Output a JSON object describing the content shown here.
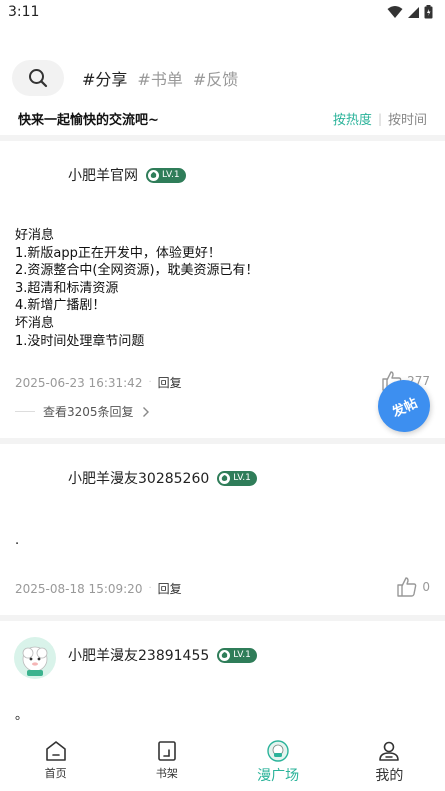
{
  "status": {
    "time": "3:11"
  },
  "header": {
    "tabs": [
      {
        "label": "#分享",
        "active": true
      },
      {
        "label": "#书单",
        "active": false
      },
      {
        "label": "#反馈",
        "active": false
      }
    ]
  },
  "subbar": {
    "slogan": "快来一起愉快的交流吧~",
    "sort_hot": "按热度",
    "sort_sep": "|",
    "sort_time": "按时间"
  },
  "posts": [
    {
      "user": "小肥羊官网",
      "level": "LV.1",
      "body": "好消息\n1.新版app正在开发中，体验更好！\n2.资源整合中(全网资源)，耽美资源已有！\n3.超清和标清资源\n4.新增广播剧！\n坏消息\n1.没时间处理章节问题",
      "time": "2025-06-23 16:31:42",
      "reply": "回复",
      "likes": "277",
      "view_replies": "查看3205条回复"
    },
    {
      "user": "小肥羊漫友30285260",
      "level": "LV.1",
      "body": ".",
      "time": "2025-08-18 15:09:20",
      "reply": "回复",
      "likes": "0"
    },
    {
      "user": "小肥羊漫友23891455",
      "level": "LV.1",
      "body": "。"
    }
  ],
  "fab": {
    "label": "发帖"
  },
  "nav": [
    {
      "label": "首页",
      "icon": "home-icon",
      "active": false
    },
    {
      "label": "书架",
      "icon": "bookshelf-icon",
      "active": false
    },
    {
      "label": "漫广场",
      "icon": "plaza-icon",
      "active": true
    },
    {
      "label": "我的",
      "icon": "profile-icon",
      "active": false
    }
  ],
  "colors": {
    "accent": "#2bb39a",
    "badge": "#2f7d59",
    "fab": "#3d8ff0"
  }
}
